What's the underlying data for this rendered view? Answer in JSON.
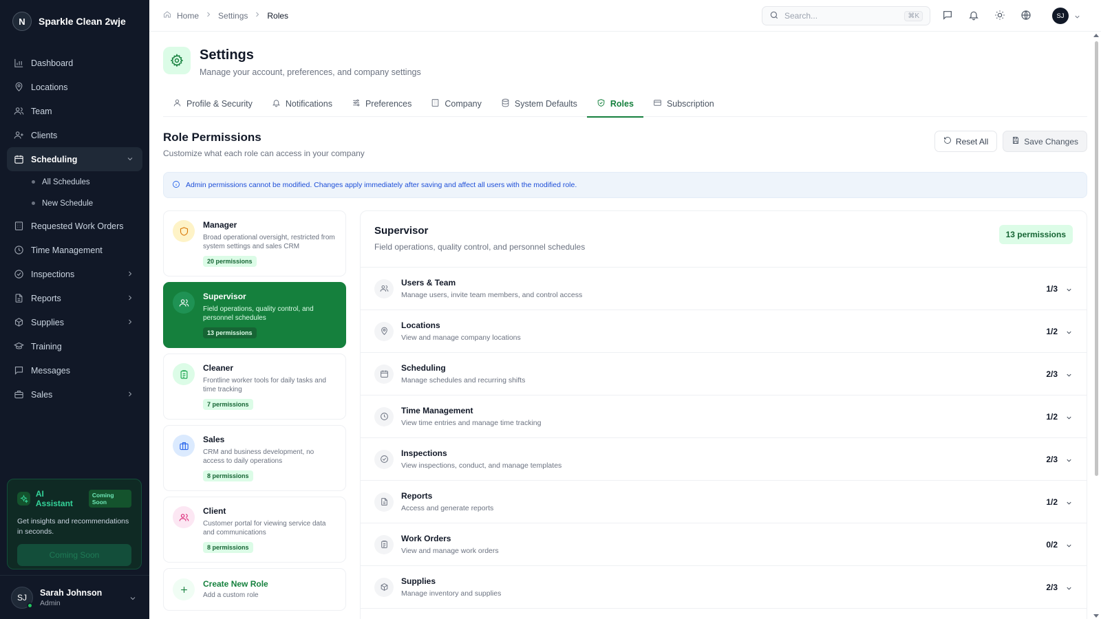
{
  "brand": {
    "logo_letter": "N",
    "name": "Sparkle Clean 2wje"
  },
  "sidebar": {
    "items": [
      {
        "label": "Dashboard",
        "icon": "chart-bar-icon"
      },
      {
        "label": "Locations",
        "icon": "map-pin-icon"
      },
      {
        "label": "Team",
        "icon": "users-icon"
      },
      {
        "label": "Clients",
        "icon": "user-plus-icon"
      },
      {
        "label": "Scheduling",
        "icon": "calendar-icon",
        "active": true,
        "expanded": true
      },
      {
        "label": "Requested Work Orders",
        "icon": "building-icon"
      },
      {
        "label": "Time Management",
        "icon": "clock-icon"
      },
      {
        "label": "Inspections",
        "icon": "check-circle-icon"
      },
      {
        "label": "Reports",
        "icon": "file-text-icon"
      },
      {
        "label": "Supplies",
        "icon": "package-icon"
      },
      {
        "label": "Training",
        "icon": "graduation-cap-icon"
      },
      {
        "label": "Messages",
        "icon": "message-square-icon"
      },
      {
        "label": "Sales",
        "icon": "briefcase-icon"
      }
    ],
    "sub_items": [
      "All Schedules",
      "New Schedule"
    ]
  },
  "ai_assistant": {
    "title": "AI Assistant",
    "badge": "Coming Soon",
    "description": "Get insights and recommendations in seconds.",
    "button": "Coming Soon"
  },
  "user": {
    "initials": "SJ",
    "name": "Sarah Johnson",
    "role": "Admin"
  },
  "topbar": {
    "breadcrumbs": [
      "Home",
      "Settings",
      "Roles"
    ],
    "search_placeholder": "Search...",
    "search_shortcut": "⌘K",
    "avatar_initials": "SJ"
  },
  "page": {
    "title": "Settings",
    "subtitle": "Manage your account, preferences, and company settings"
  },
  "tabs": [
    {
      "label": "Profile & Security",
      "icon": "user-icon"
    },
    {
      "label": "Notifications",
      "icon": "bell-icon"
    },
    {
      "label": "Preferences",
      "icon": "sliders-icon"
    },
    {
      "label": "Company",
      "icon": "building-icon"
    },
    {
      "label": "System Defaults",
      "icon": "database-icon"
    },
    {
      "label": "Roles",
      "icon": "shield-check-icon",
      "active": true
    },
    {
      "label": "Subscription",
      "icon": "credit-card-icon"
    }
  ],
  "role_permissions": {
    "title": "Role Permissions",
    "subtitle": "Customize what each role can access in your company",
    "reset_label": "Reset All",
    "save_label": "Save Changes",
    "info": "Admin permissions cannot be modified. Changes apply immediately after saving and affect all users with the modified role."
  },
  "roles": [
    {
      "name": "Manager",
      "description": "Broad operational oversight, restricted from system settings and sales CRM",
      "badge": "20 permissions",
      "icon": "shield-icon",
      "icon_color": "#d97706",
      "icon_bg": "#fef3c7"
    },
    {
      "name": "Supervisor",
      "description": "Field operations, quality control, and personnel schedules",
      "badge": "13 permissions",
      "icon": "users-icon",
      "icon_color": "#ffffff",
      "icon_bg": "#1f9254",
      "selected": true
    },
    {
      "name": "Cleaner",
      "description": "Frontline worker tools for daily tasks and time tracking",
      "badge": "7 permissions",
      "icon": "clipboard-icon",
      "icon_color": "#16a34a",
      "icon_bg": "#dcfce7"
    },
    {
      "name": "Sales",
      "description": "CRM and business development, no access to daily operations",
      "badge": "8 permissions",
      "icon": "briefcase-icon",
      "icon_color": "#2563eb",
      "icon_bg": "#dbeafe"
    },
    {
      "name": "Client",
      "description": "Customer portal for viewing service data and communications",
      "badge": "8 permissions",
      "icon": "users-icon",
      "icon_color": "#db2777",
      "icon_bg": "#fce7f3"
    }
  ],
  "create_role": {
    "name": "Create New Role",
    "description": "Add a custom role"
  },
  "detail": {
    "title": "Supervisor",
    "subtitle": "Field operations, quality control, and personnel schedules",
    "badge": "13 permissions",
    "groups": [
      {
        "name": "Users & Team",
        "description": "Manage users, invite team members, and control access",
        "count": "1/3",
        "icon": "users-icon"
      },
      {
        "name": "Locations",
        "description": "View and manage company locations",
        "count": "1/2",
        "icon": "map-pin-icon"
      },
      {
        "name": "Scheduling",
        "description": "Manage schedules and recurring shifts",
        "count": "2/3",
        "icon": "calendar-icon"
      },
      {
        "name": "Time Management",
        "description": "View time entries and manage time tracking",
        "count": "1/2",
        "icon": "clock-icon"
      },
      {
        "name": "Inspections",
        "description": "View inspections, conduct, and manage templates",
        "count": "2/3",
        "icon": "check-circle-icon"
      },
      {
        "name": "Reports",
        "description": "Access and generate reports",
        "count": "1/2",
        "icon": "file-text-icon"
      },
      {
        "name": "Work Orders",
        "description": "View and manage work orders",
        "count": "0/2",
        "icon": "clipboard-icon"
      },
      {
        "name": "Supplies",
        "description": "Manage inventory and supplies",
        "count": "2/3",
        "icon": "package-icon"
      }
    ]
  }
}
